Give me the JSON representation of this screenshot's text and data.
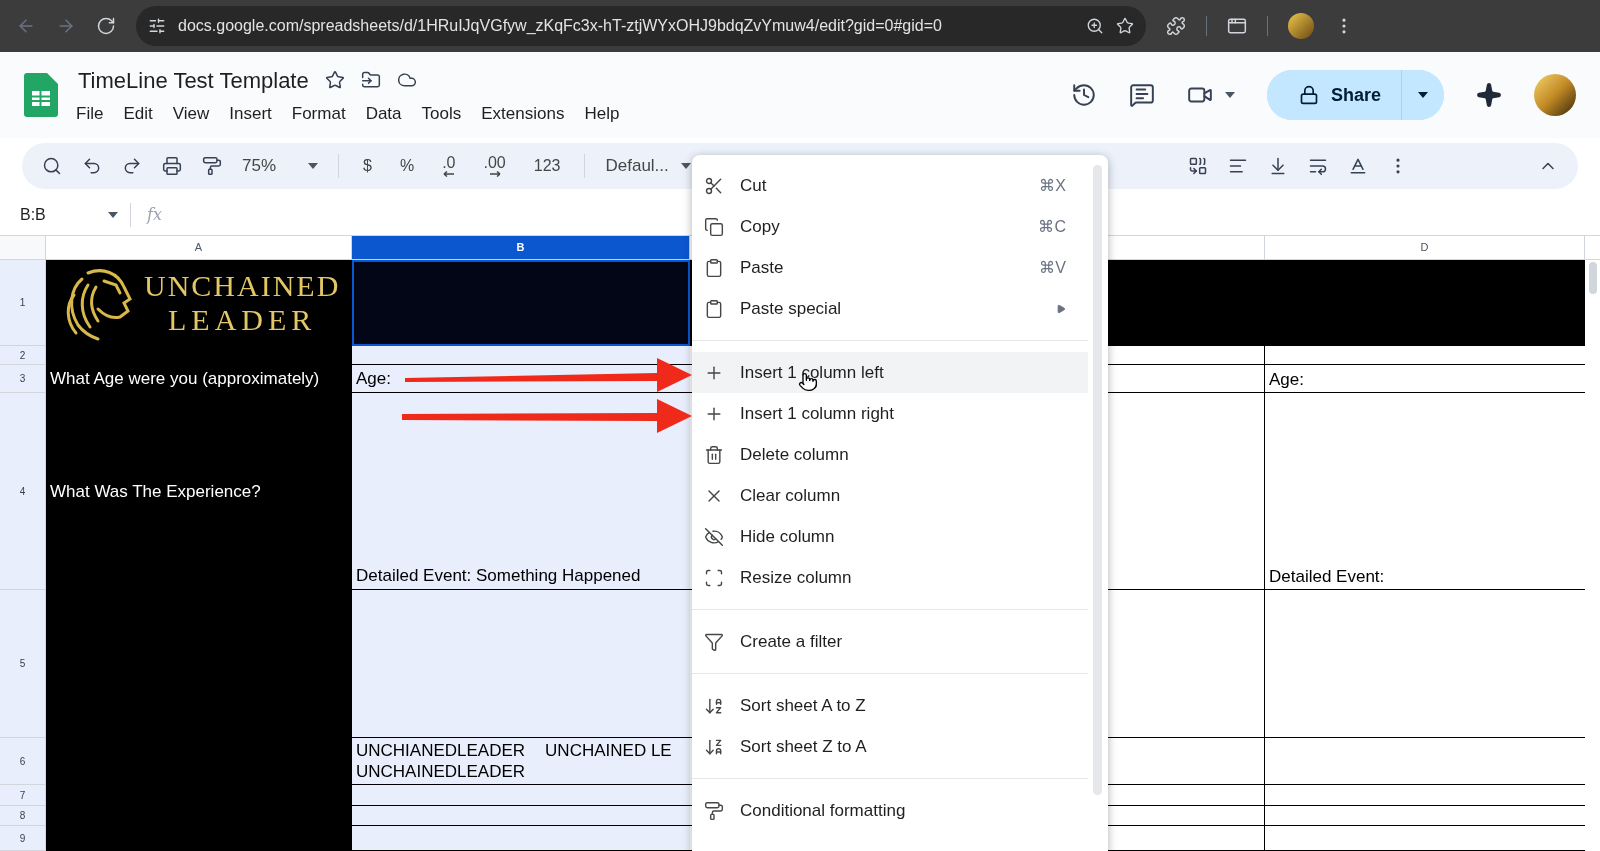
{
  "browser": {
    "url": "docs.google.com/spreadsheets/d/1HRuIJqVGfyw_zKqFc3x-hT-ztjWYxOHJ9bdqZvYmuw4/edit?gid=0#gid=0"
  },
  "document": {
    "title": "TimeLine Test Template",
    "menus": [
      "File",
      "Edit",
      "View",
      "Insert",
      "Format",
      "Data",
      "Tools",
      "Extensions",
      "Help"
    ],
    "share_label": "Share"
  },
  "toolbar": {
    "zoom": "75%",
    "format_buttons": [
      "$",
      "%",
      ".0",
      ".00",
      "123"
    ],
    "font": "Defaul..."
  },
  "formula_bar": {
    "name_box": "B:B",
    "fx_label": "fx"
  },
  "sheet": {
    "columns": [
      {
        "label": "A",
        "selected": false
      },
      {
        "label": "B",
        "selected": true
      },
      {
        "label": "D",
        "selected": false
      }
    ],
    "rows": [
      "1",
      "2",
      "3",
      "4",
      "5",
      "6",
      "7",
      "8",
      "9"
    ],
    "logo": [
      "UNCHAINED",
      "LEADER"
    ],
    "column_a": {
      "row_3": "What Age were you (approximately)",
      "row_4": "What Was The Experience?"
    },
    "column_b": {
      "row_3": "Age:",
      "row_4": "Detailed Event: Something Happened",
      "row_6": [
        "UNCHIANEDLEADER",
        "UNCHAINED LE",
        "UNCHAINEDLEADER"
      ]
    },
    "column_d": {
      "row_3": "Age:",
      "row_4": "Detailed Event:"
    }
  },
  "context_menu": {
    "items": [
      {
        "kind": "item",
        "label": "Cut",
        "shortcut": "⌘X",
        "submenu": false,
        "selected": false
      },
      {
        "kind": "item",
        "label": "Copy",
        "shortcut": "⌘C",
        "submenu": false,
        "selected": false
      },
      {
        "kind": "item",
        "label": "Paste",
        "shortcut": "⌘V",
        "submenu": false,
        "selected": false
      },
      {
        "kind": "item",
        "label": "Paste special",
        "submenu": true,
        "selected": false
      },
      {
        "kind": "divider"
      },
      {
        "kind": "item",
        "label": "Insert 1 column left",
        "submenu": false,
        "selected": true
      },
      {
        "kind": "item",
        "label": "Insert 1 column right",
        "submenu": false,
        "selected": false
      },
      {
        "kind": "item",
        "label": "Delete column",
        "submenu": false,
        "selected": false
      },
      {
        "kind": "item",
        "label": "Clear column",
        "submenu": false,
        "selected": false
      },
      {
        "kind": "item",
        "label": "Hide column",
        "submenu": false,
        "selected": false
      },
      {
        "kind": "item",
        "label": "Resize column",
        "submenu": false,
        "selected": false
      },
      {
        "kind": "divider"
      },
      {
        "kind": "item",
        "label": "Create a filter",
        "submenu": false,
        "selected": false
      },
      {
        "kind": "divider"
      },
      {
        "kind": "item",
        "label": "Sort sheet A to Z",
        "submenu": false,
        "selected": false
      },
      {
        "kind": "item",
        "label": "Sort sheet Z to A",
        "submenu": false,
        "selected": false
      },
      {
        "kind": "divider"
      },
      {
        "kind": "item",
        "label": "Conditional formatting",
        "submenu": false,
        "selected": false
      }
    ]
  }
}
